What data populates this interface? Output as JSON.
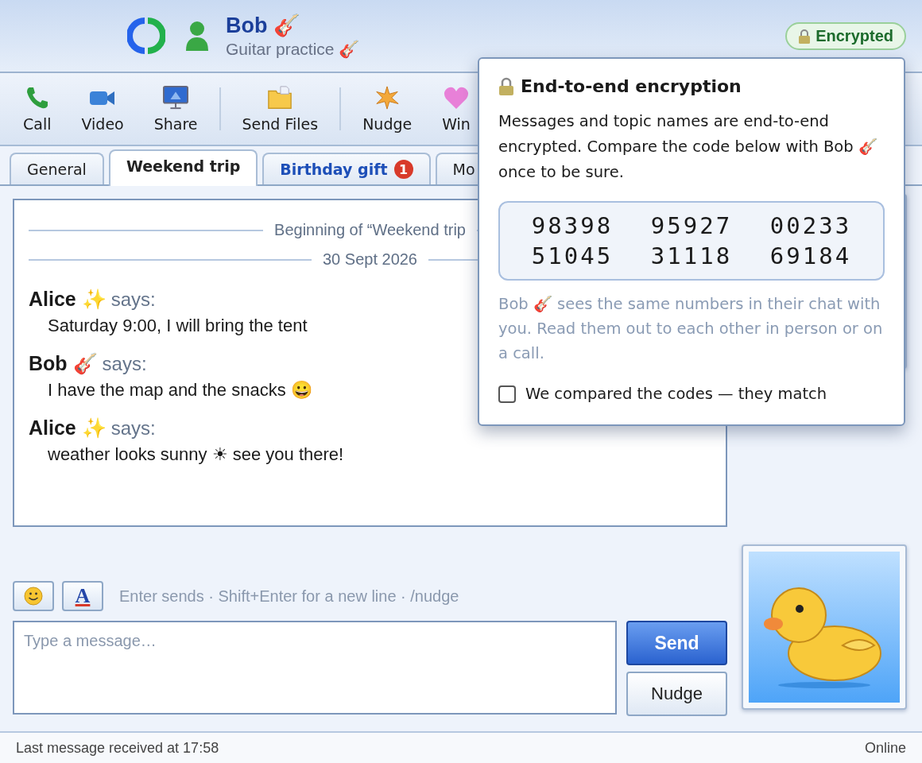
{
  "header": {
    "name": "Bob 🎸",
    "status": "Guitar practice 🎸",
    "badge": "Encrypted"
  },
  "toolbar": [
    {
      "items": [
        {
          "label": "Call",
          "kind": "phone"
        },
        {
          "label": "Video",
          "kind": "camera"
        },
        {
          "label": "Share",
          "kind": "monitor"
        }
      ]
    },
    {
      "items": [
        {
          "label": "Send Files",
          "kind": "folder"
        }
      ]
    },
    {
      "items": [
        {
          "label": "Nudge",
          "kind": "burst"
        },
        {
          "label": "Win",
          "kind": "heart"
        }
      ]
    }
  ],
  "tabs": [
    {
      "label": "General",
      "selected": false,
      "unread": false
    },
    {
      "label": "Weekend trip",
      "selected": true,
      "unread": false
    },
    {
      "label": "Birthday gift",
      "selected": false,
      "unread": true,
      "badge": "1"
    },
    {
      "label": "Mo",
      "selected": false,
      "unread": false
    }
  ],
  "chat": {
    "dividers": [
      "Beginning of “Weekend trip",
      "30 Sept 2026"
    ],
    "messages": [
      {
        "sender": "Alice ✨",
        "says": "says:",
        "text": "Saturday 9:00, I will bring the tent"
      },
      {
        "sender": "Bob 🎸",
        "says": "says:",
        "text": "I have the map and the snacks 😀"
      },
      {
        "sender": "Alice ✨",
        "says": "says:",
        "text": "weather looks sunny ☀ see you there!"
      }
    ]
  },
  "composer": {
    "font_button": "A",
    "hint": "Enter sends · Shift+Enter for a new line · /nudge",
    "placeholder": "Type a message…",
    "send": "Send",
    "nudge": "Nudge"
  },
  "popover": {
    "title": "End-to-end encryption",
    "body": "Messages and topic names are end-to-end encrypted. Compare the code below with Bob 🎸 once to be sure.",
    "codes": [
      "98398",
      "95927",
      "00233",
      "51045",
      "31118",
      "69184"
    ],
    "note": "Bob 🎸 sees the same numbers in their chat with you. Read them out to each other in person or on a call.",
    "checkbox": {
      "label": "We compared the codes — they match",
      "checked": false
    }
  },
  "status_bar": {
    "left": "Last message received at 17:58",
    "right": "Online"
  }
}
